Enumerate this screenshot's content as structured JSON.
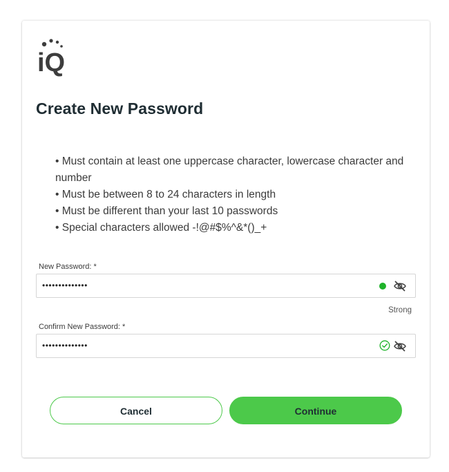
{
  "logo": {
    "alt": "iQ",
    "text": "iQ"
  },
  "title": "Create New Password",
  "rules": [
    "Must contain at least one uppercase character, lowercase character and number",
    "Must be between 8 to 24 characters in length",
    "Must be different than your last 10 passwords",
    "Special characters allowed -!@#$%^&*()_+"
  ],
  "new_password": {
    "label": "New Password: *",
    "value": "••••••••••••••",
    "strength_color": "#1fb32a",
    "strength_text": "Strong"
  },
  "confirm_password": {
    "label": "Confirm New Password: *",
    "value": "••••••••••••••",
    "match_color": "#1fb32a"
  },
  "buttons": {
    "cancel": "Cancel",
    "continue": "Continue"
  },
  "colors": {
    "accent": "#4cc94a",
    "title": "#1f2d33",
    "logo": "#3d3d3d"
  },
  "icons": {
    "visibility_toggle": "eye-slash-icon",
    "match_indicator": "check-circle-icon",
    "strength_indicator": "strength-dot"
  }
}
